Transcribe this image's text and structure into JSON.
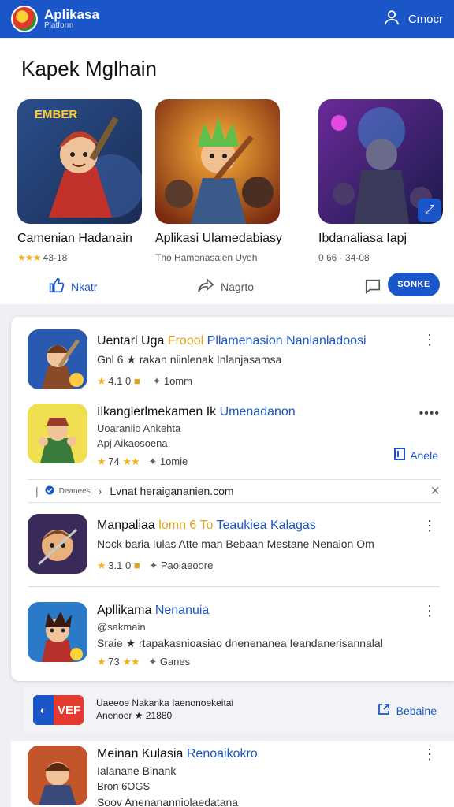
{
  "appbar": {
    "brand": "Aplikasa",
    "brand_sub": "Platform",
    "account_label": "Cmocr"
  },
  "featured": {
    "title": "Kapek Mglhain",
    "games": [
      {
        "name": "Camenian Hadanain",
        "meta": "43-18",
        "thumb_label": "EMBER"
      },
      {
        "name": "Aplikasi Ulamedabiasy",
        "meta": "Tho Hamenasalen Uyeh",
        "thumb_label": ""
      },
      {
        "name": "Ibdanaliasa Iapj",
        "meta": "0 66 · 34-08",
        "thumb_label": ""
      }
    ],
    "actions": {
      "like": "Nkatr",
      "share": "Nagrto",
      "save": "SONKE"
    }
  },
  "list": {
    "rows": [
      {
        "title": "Uentarl Uga",
        "title_gold": "Froool",
        "title_blue": "Pllamenasion Nanlanladoosi",
        "line2": "Gnl 6 ★ rakan niinlenak Inlanjasamsa",
        "meta_rating": "4.1 0",
        "meta_right": "1omm"
      },
      {
        "title": "Ilkanglerlmekamen Ik",
        "title_blue": "Umenadanon",
        "line2": "Uoaraniio Ankehta",
        "line3": "Apj Aikaosoena",
        "meta_rating": "74",
        "meta_right": "1omie",
        "action": "Anele"
      },
      {
        "title": "Manpaliaa",
        "title_gold": "lomn 6 To",
        "title_blue": "Teaukiea Kalagas",
        "line2": "Nock baria Iulas Atte man Bebaan Mestane Nenaion Om",
        "meta_rating": "3.1 0",
        "meta_right": "Paolaeoore"
      },
      {
        "title": "Apllikama",
        "title_blue": "Nenanuia",
        "line2": "@sakmain",
        "line3": "Sraie ★ rtapakasnioasiao dnenenanea Ieandanerisannalal",
        "meta_rating": "73",
        "meta_right": "Ganes"
      }
    ],
    "url_bar": {
      "source": "Deanees",
      "url": "Lvnat heraigananien.com"
    }
  },
  "sponsored": {
    "logo_text": "VEF",
    "line1": "Uaeeoe Nakanka Iaenonoekeitai",
    "line2": "Anenoer ★ 21880",
    "action": "Bebaine"
  },
  "lastrow": {
    "title": "Meinan Kulasia",
    "title_blue": "Renoaikokro",
    "line2": "Ialanane Binank",
    "line3": "Bron 6OGS",
    "line4": "Soov Anenananniolaedatana"
  },
  "colors": {
    "primary": "#1a56c8",
    "star": "#f3b21a",
    "background": "#eef0f3"
  }
}
